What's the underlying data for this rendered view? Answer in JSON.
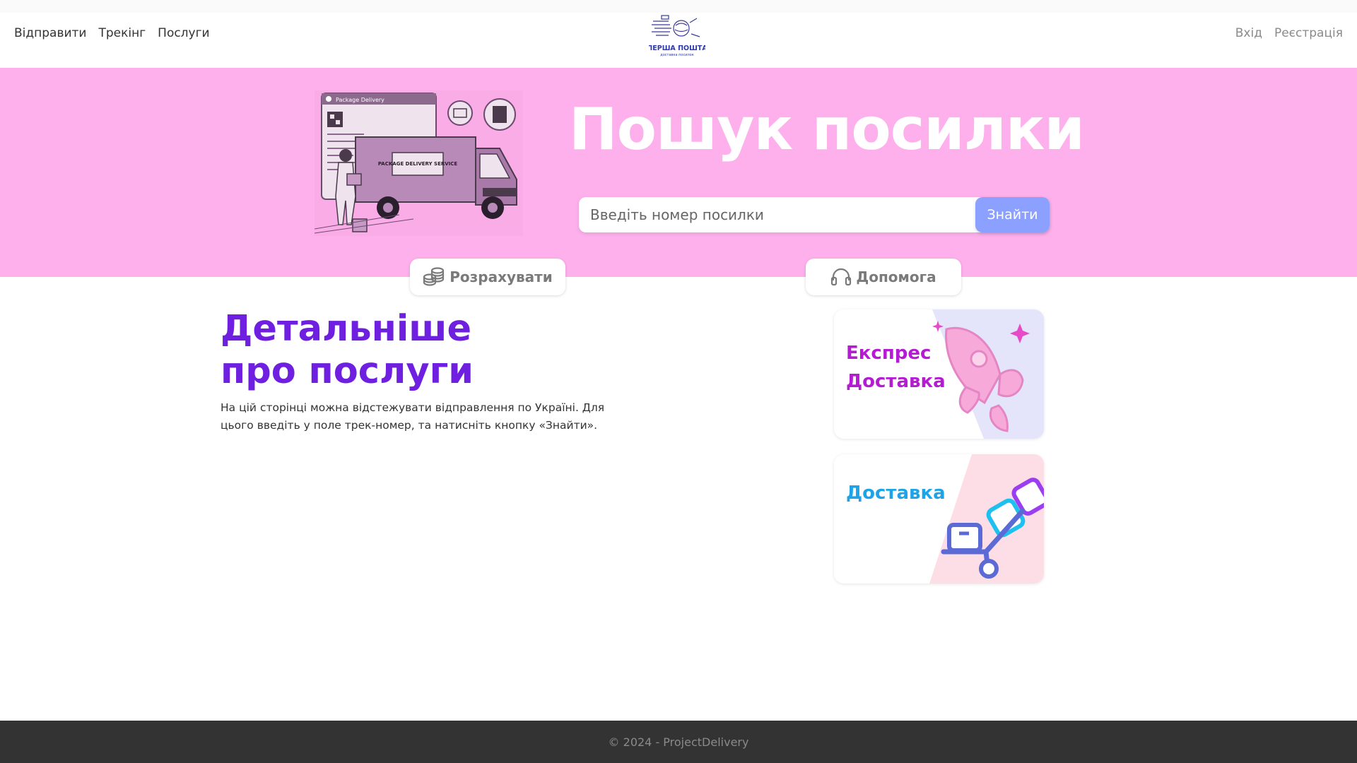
{
  "nav": {
    "left_links": [
      "Відправити",
      "Трекінг",
      "Послуги"
    ],
    "right_links": [
      "Вхід",
      "Реєстрація"
    ]
  },
  "logo": {
    "title": "ПЕРША ПОШТА",
    "subtitle": "доставка посилок"
  },
  "hero": {
    "title": "Пошук посилки",
    "search_placeholder": "Введіть номер посилки",
    "search_button": "Знайти",
    "illustration": {
      "window_title": "Package Delivery",
      "truck_text": "PACKAGE DELIVERY SERVICE"
    }
  },
  "actions": {
    "calculate_label": "Розрахувати",
    "calculate_icon": "coins-icon",
    "help_label": "Допомога",
    "help_icon": "headset-icon"
  },
  "info": {
    "title_line1": "Детальніше",
    "title_line2": "про послуги",
    "text": "На цій сторінці можна відстежувати відправлення по Україні. Для цього введіть у поле трек-номер, та натисніть кнопку «Знайти»."
  },
  "cards": {
    "express_line1": "Експрес",
    "express_line2": "Доставка",
    "delivery_label": "Доставка"
  },
  "footer": {
    "text": "© 2024 - ProjectDelivery"
  },
  "colors": {
    "hero_bg": "#fdb0ec",
    "accent_purple": "#6f1fe0",
    "express_label": "#b51bd2",
    "delivery_label": "#1da4e8",
    "search_button": "#8ca0ff",
    "footer_bg": "#333333"
  }
}
